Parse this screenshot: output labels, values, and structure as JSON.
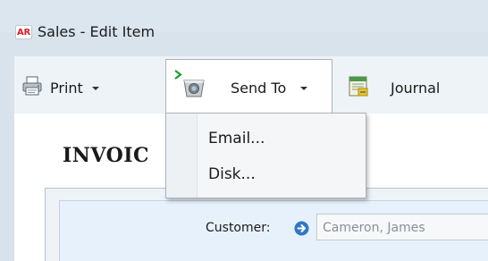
{
  "window": {
    "app_badge": "AR",
    "title": "Sales - Edit Item"
  },
  "toolbar": {
    "print_label": "Print",
    "send_to_label": "Send To",
    "journal_label": "Journal",
    "icons": {
      "print": "printer-icon",
      "send_to": "send-to-icon",
      "journal": "journal-icon"
    }
  },
  "send_to_menu": {
    "items": [
      {
        "label": "Email..."
      },
      {
        "label": "Disk..."
      }
    ]
  },
  "document": {
    "title": "INVOIC"
  },
  "customer": {
    "label": "Customer:",
    "value": "Cameron, James",
    "nav_icon": "arrow-right-circle-icon"
  },
  "colors": {
    "title_bar": "#dce6ef",
    "toolbar": "#eef3f7",
    "badge_text": "#d81f26",
    "nav_arrow": "#2f78c4",
    "menu_arrow": "#1e9e2e"
  }
}
